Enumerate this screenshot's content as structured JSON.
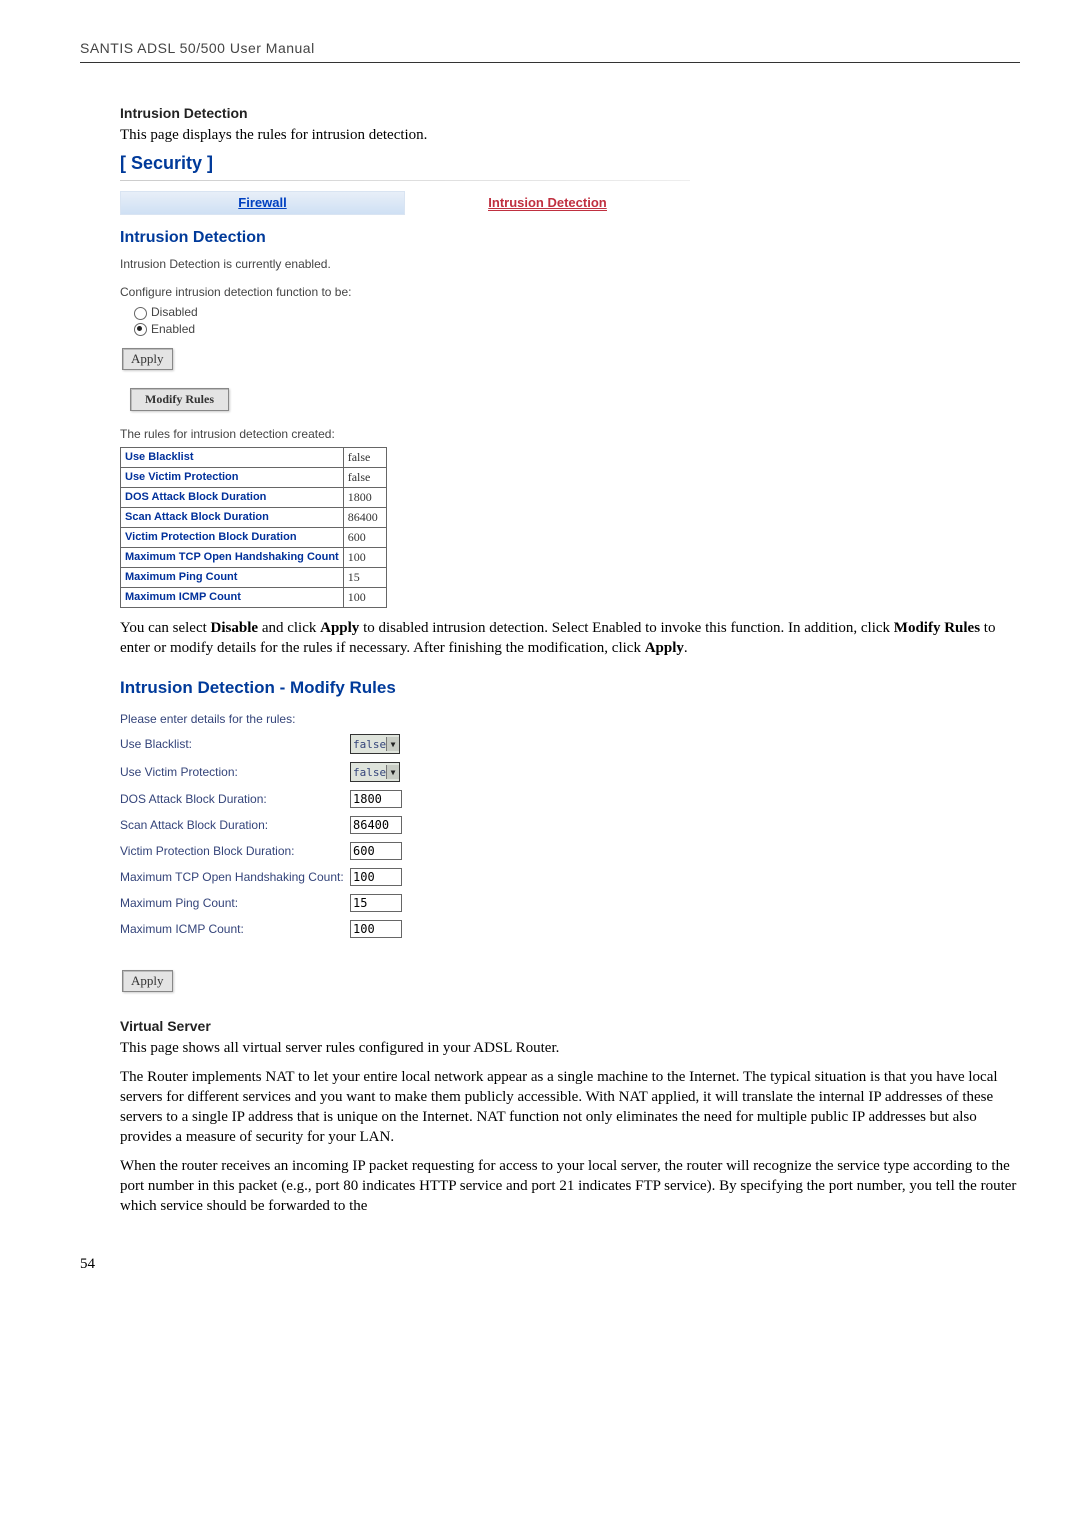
{
  "running_head": "SANTIS ADSL 50/500 User Manual",
  "sec1_title": "Intrusion Detection",
  "sec1_desc": "This page displays the rules for intrusion detection.",
  "ui": {
    "heading": "[ Security ]",
    "tabs": {
      "firewall": "Firewall",
      "intrusion": "Intrusion Detection"
    },
    "sub": "Intrusion Detection",
    "status": "Intrusion Detection is currently enabled.",
    "configure": "Configure intrusion detection function to be:",
    "radio_disabled": "Disabled",
    "radio_enabled": "Enabled",
    "apply": "Apply",
    "modify_rules_btn": "Modify Rules",
    "rules_caption": "The rules for intrusion detection created:",
    "rules": [
      {
        "label": "Use Blacklist",
        "value": "false"
      },
      {
        "label": "Use Victim Protection",
        "value": "false"
      },
      {
        "label": "DOS Attack Block Duration",
        "value": "1800"
      },
      {
        "label": "Scan Attack Block Duration",
        "value": "86400"
      },
      {
        "label": "Victim Protection Block Duration",
        "value": "600"
      },
      {
        "label": "Maximum TCP Open Handshaking Count",
        "value": "100"
      },
      {
        "label": "Maximum Ping Count",
        "value": "15"
      },
      {
        "label": "Maximum ICMP Count",
        "value": "100"
      }
    ]
  },
  "para_after_rules_1": "You can select ",
  "para_after_rules_bold1": "Disable",
  "para_after_rules_2": " and click ",
  "para_after_rules_bold2": "Apply",
  "para_after_rules_3": " to disabled intrusion detection. Select Enabled to invoke this function. In addition, click ",
  "para_after_rules_bold3": "Modify Rules",
  "para_after_rules_4": " to enter or modify details for the rules if necessary. After finishing the modification, click ",
  "para_after_rules_bold4": "Apply",
  "para_after_rules_5": ".",
  "modify": {
    "heading": "Intrusion Detection - Modify Rules",
    "intro": "Please enter details for the rules:",
    "fields": [
      {
        "label": "Use Blacklist:",
        "type": "select",
        "value": "false"
      },
      {
        "label": "Use Victim Protection:",
        "type": "select",
        "value": "false"
      },
      {
        "label": "DOS Attack Block Duration:",
        "type": "text",
        "value": "1800"
      },
      {
        "label": "Scan Attack Block Duration:",
        "type": "text",
        "value": "86400"
      },
      {
        "label": "Victim Protection Block Duration:",
        "type": "text",
        "value": "600"
      },
      {
        "label": "Maximum TCP Open Handshaking Count:",
        "type": "text",
        "value": "100"
      },
      {
        "label": "Maximum Ping Count:",
        "type": "text",
        "value": "15"
      },
      {
        "label": "Maximum ICMP Count:",
        "type": "text",
        "value": "100"
      }
    ],
    "apply": "Apply"
  },
  "vs_title": "Virtual Server",
  "vs_desc": "This page shows all virtual server rules configured in your ADSL Router.",
  "vs_p2": "The Router implements NAT to let your entire local network appear as a single machine to the Internet. The typical situation is that you have local servers for different services and you want to make them publicly accessible. With NAT applied, it will translate the internal IP addresses of these servers to a single IP address that is unique on the Internet. NAT function not only eliminates the need for multiple public IP addresses but also provides a measure of security for your LAN.",
  "vs_p3": "When the router receives an incoming IP packet requesting for access to your local server, the router will recognize the service type according to the port number in this packet (e.g., port 80 indicates HTTP service and port 21 indicates FTP service). By specifying the port number, you tell the router which service should be forwarded to the",
  "page_number": "54"
}
